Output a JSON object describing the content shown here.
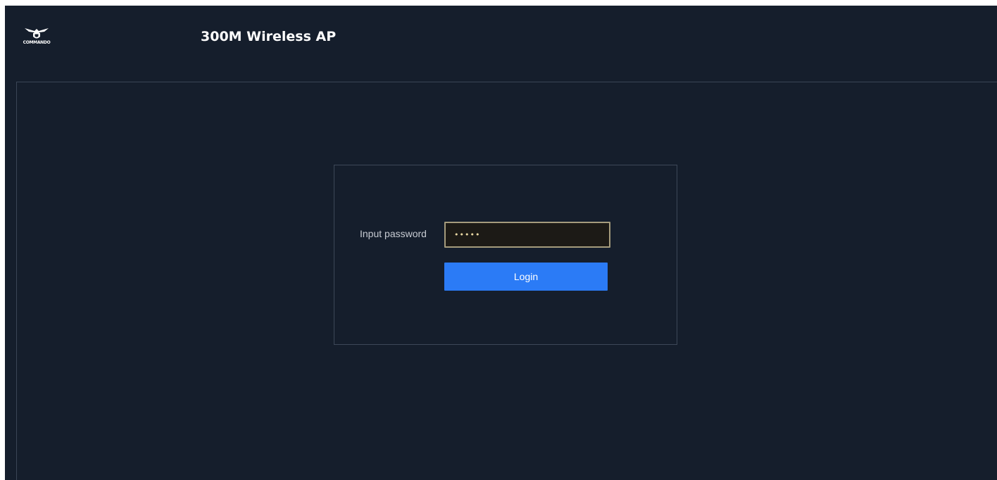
{
  "header": {
    "logo_text": "COMMANDO",
    "title": "300M Wireless AP"
  },
  "login": {
    "password_label": "Input password",
    "password_value": "admin",
    "login_button": "Login"
  },
  "colors": {
    "background": "#151e2c",
    "accent": "#2b7bf6",
    "input_border": "#a59b7c"
  },
  "icons": {
    "logo": "eagle-shield-logo-icon"
  }
}
